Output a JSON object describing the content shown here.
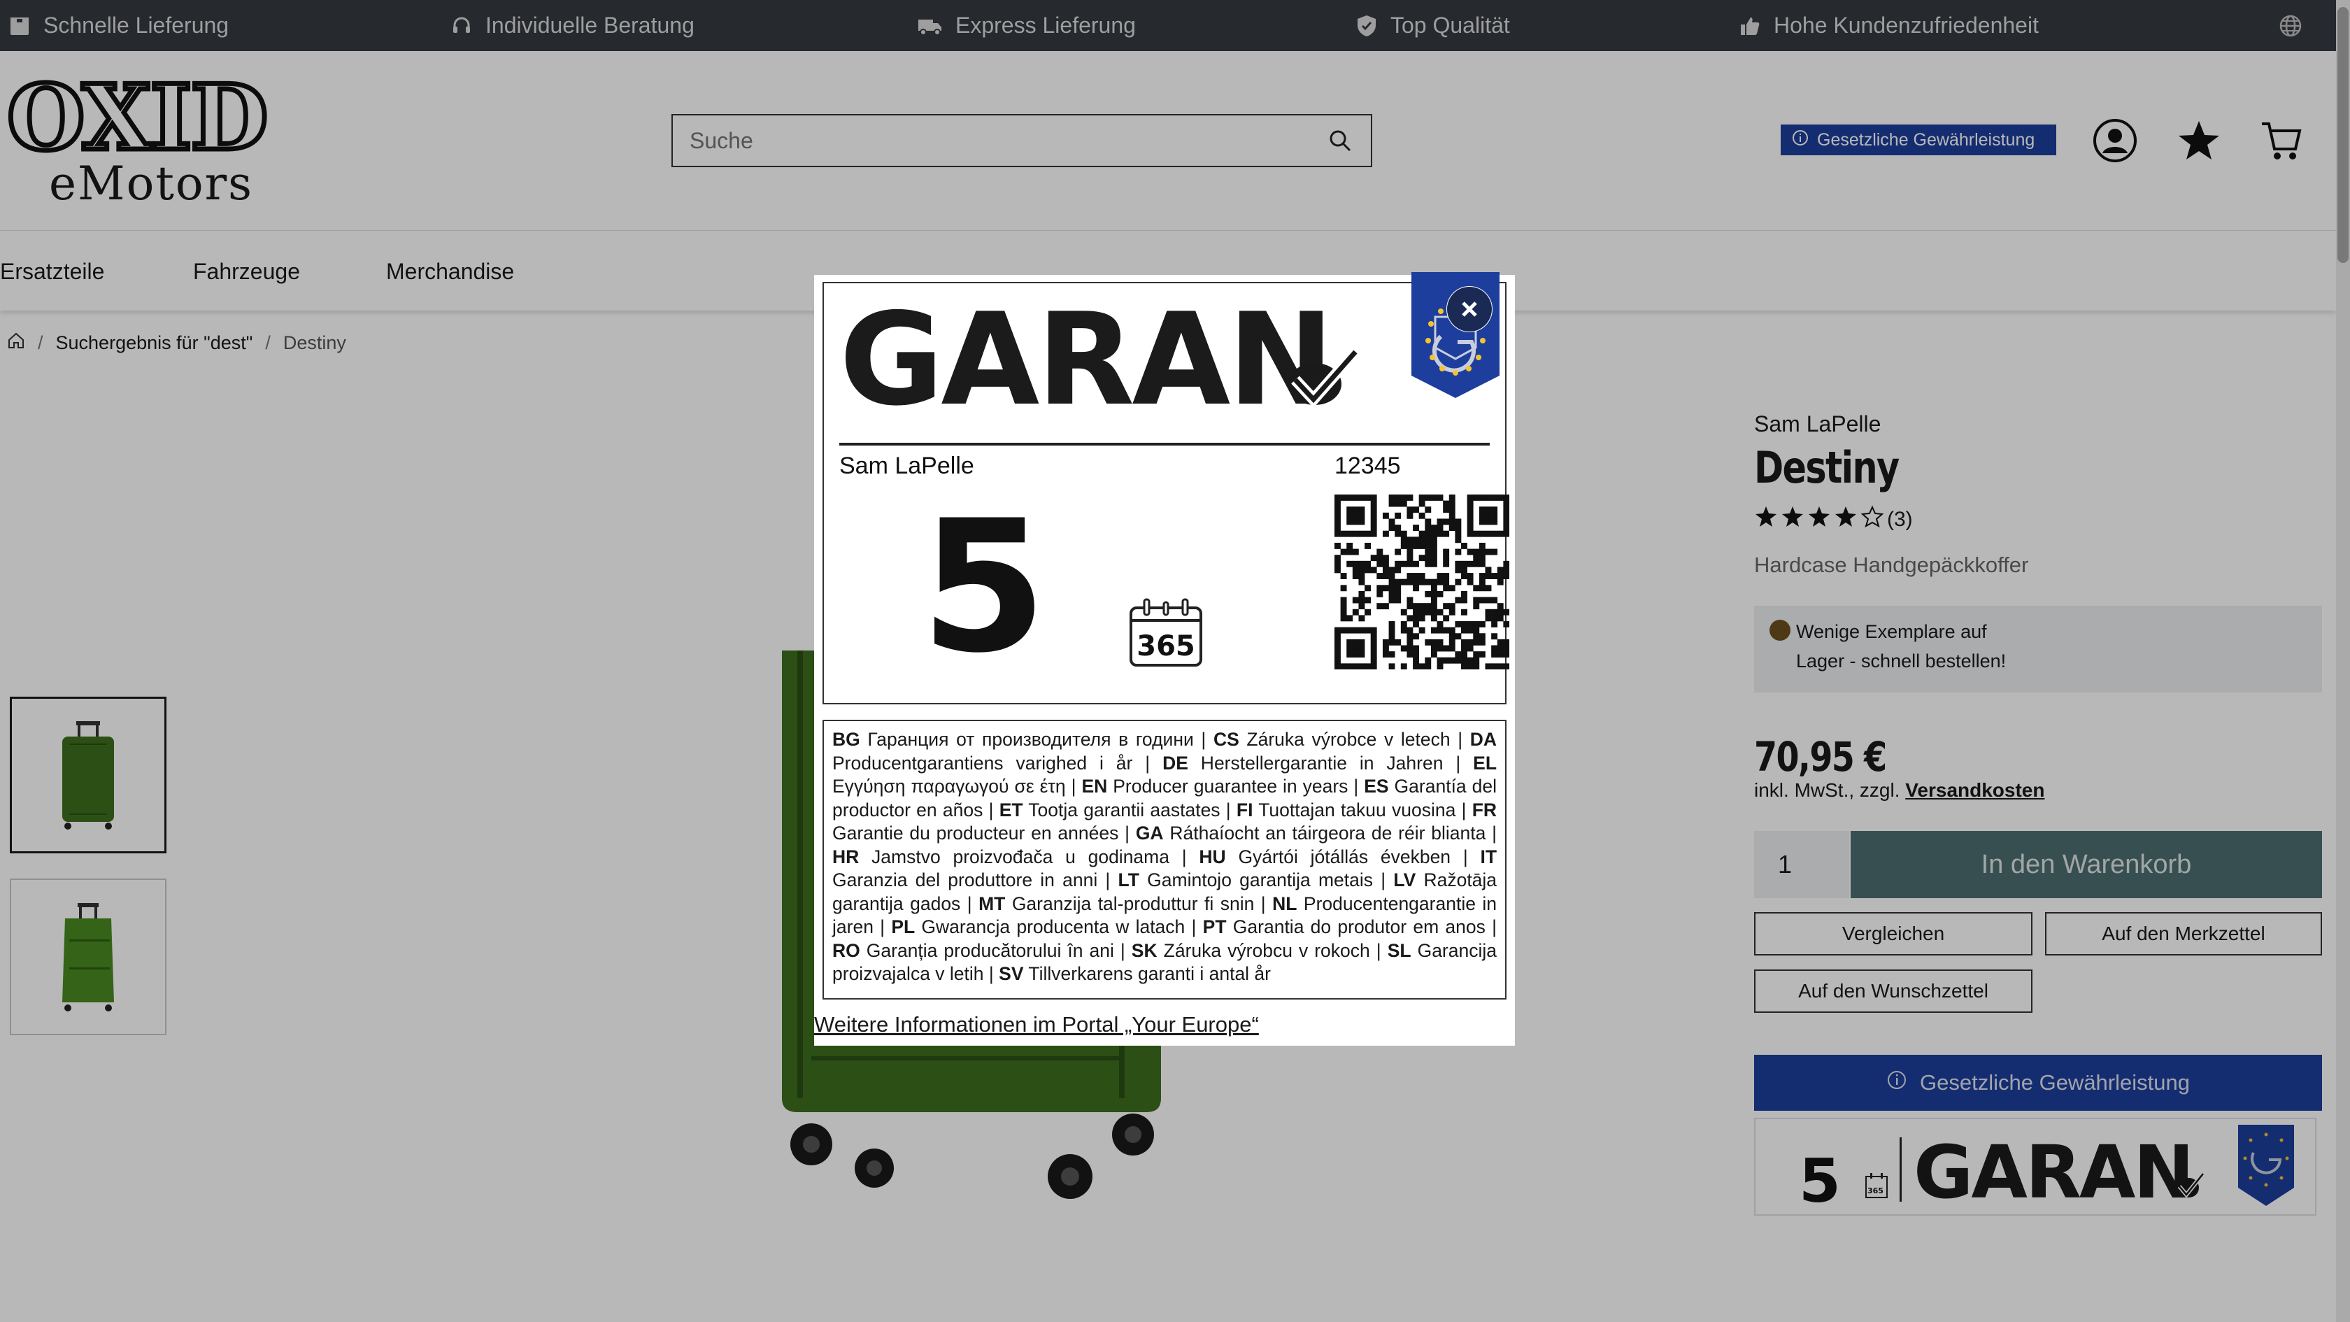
{
  "topbar": {
    "items": [
      {
        "label": "Schnelle Lieferung",
        "icon": "box-icon"
      },
      {
        "label": "Individuelle Beratung",
        "icon": "headset-icon"
      },
      {
        "label": "Express Lieferung",
        "icon": "truck-icon"
      },
      {
        "label": "Top Qualität",
        "icon": "shield-check-icon"
      },
      {
        "label": "Hohe Kundenzufriedenheit",
        "icon": "thumbs-up-icon"
      }
    ]
  },
  "header": {
    "logo_top": "OXID",
    "logo_bottom": "eMotors",
    "search_placeholder": "Suche",
    "warranty_chip": "Gesetzliche Gewährleistung"
  },
  "nav": {
    "items": [
      "Ersatzteile",
      "Fahrzeuge",
      "Merchandise"
    ]
  },
  "breadcrumb": {
    "search": "Suchergebnis für \"dest\"",
    "current": "Destiny"
  },
  "product": {
    "brand": "Sam LaPelle",
    "name": "Destiny",
    "rating": 4,
    "rating_count": "(3)",
    "subtitle": "Hardcase Handgepäckkoffer",
    "stock_line1": "Wenige Exemplare auf",
    "stock_line2": "Lager - schnell bestellen!",
    "price": "70,95 €",
    "tax_prefix": "inkl. MwSt., zzgl. ",
    "tax_link": "Versandkosten",
    "quantity": "1",
    "cart_button": "In den Warenkorb",
    "compare_button": "Vergleichen",
    "notepad_button": "Auf den Merkzettel",
    "wishlist_button": "Auf den Wunschzettel",
    "warranty_bar": "Gesetzliche Gewährleistung",
    "mini_years": "5",
    "mini_word": "GARAN",
    "mini_cal": "365"
  },
  "modal": {
    "word": "GARAN",
    "seller": "Sam LaPelle",
    "number": "12345",
    "years": "5",
    "calendar_label": "365",
    "languages": [
      {
        "code": "BG",
        "text": "Гаранция от производителя в години"
      },
      {
        "code": "CS",
        "text": "Záruka výrobce v letech"
      },
      {
        "code": "DA",
        "text": "Producentgarantiens varighed i år"
      },
      {
        "code": "DE",
        "text": "Herstellergarantie in Jahren"
      },
      {
        "code": "EL",
        "text": "Εγγύηση παραγωγού σε έτη"
      },
      {
        "code": "EN",
        "text": "Producer guarantee in years"
      },
      {
        "code": "ES",
        "text": "Garantía del productor en años"
      },
      {
        "code": "ET",
        "text": "Tootja garantii aastates"
      },
      {
        "code": "FI",
        "text": "Tuottajan takuu vuosina"
      },
      {
        "code": "FR",
        "text": "Garantie du producteur en années"
      },
      {
        "code": "GA",
        "text": "Ráthaíocht an táirgeora de réir blianta"
      },
      {
        "code": "HR",
        "text": "Jamstvo proizvođača u godinama"
      },
      {
        "code": "HU",
        "text": "Gyártói jótállás években"
      },
      {
        "code": "IT",
        "text": "Garanzia del produttore in anni"
      },
      {
        "code": "LT",
        "text": "Gamintojo garantija metais"
      },
      {
        "code": "LV",
        "text": "Ražotāja garantija gados"
      },
      {
        "code": "MT",
        "text": "Garanzija tal-produttur fi snin"
      },
      {
        "code": "NL",
        "text": "Producentengarantie in jaren"
      },
      {
        "code": "PL",
        "text": "Gwarancja producenta w latach"
      },
      {
        "code": "PT",
        "text": "Garantia do produtor em anos"
      },
      {
        "code": "RO",
        "text": "Garanția producătorului în ani"
      },
      {
        "code": "SK",
        "text": "Záruka výrobcu v rokoch"
      },
      {
        "code": "SL",
        "text": "Garancija proizvajalca v letih"
      },
      {
        "code": "SV",
        "text": "Tillverkarens garanti i antal år"
      }
    ],
    "link": "Weitere Informationen im Portal „Your Europe“"
  },
  "colors": {
    "topbar_bg": "#353a40",
    "eu_blue": "#1d3e9c",
    "cart_button": "#4e6e72",
    "suitcase_green": "#3d6e1e"
  }
}
